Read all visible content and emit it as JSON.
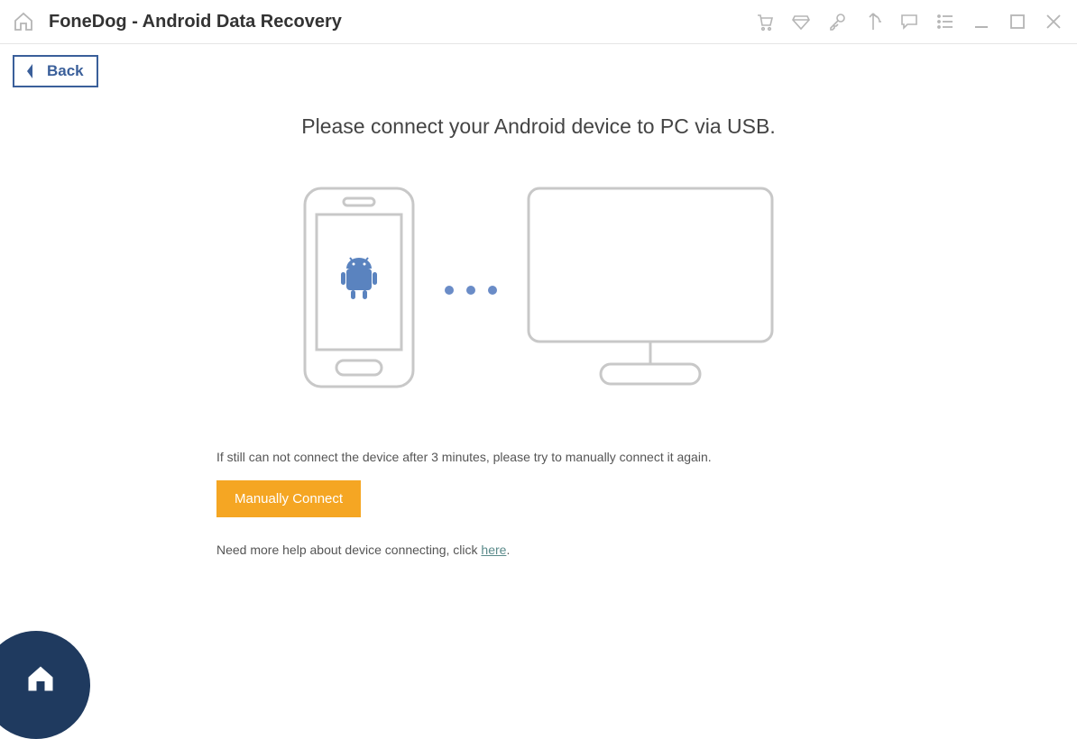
{
  "titlebar": {
    "title": "FoneDog - Android Data Recovery"
  },
  "toolbar": {
    "back_label": "Back"
  },
  "content": {
    "heading": "Please connect your Android device to PC via USB.",
    "note": "If still can not connect the device after 3 minutes, please try to manually connect it again.",
    "manual_button": "Manually Connect",
    "help_prefix": "Need more help about device connecting, click ",
    "help_link": "here",
    "help_suffix": "."
  }
}
